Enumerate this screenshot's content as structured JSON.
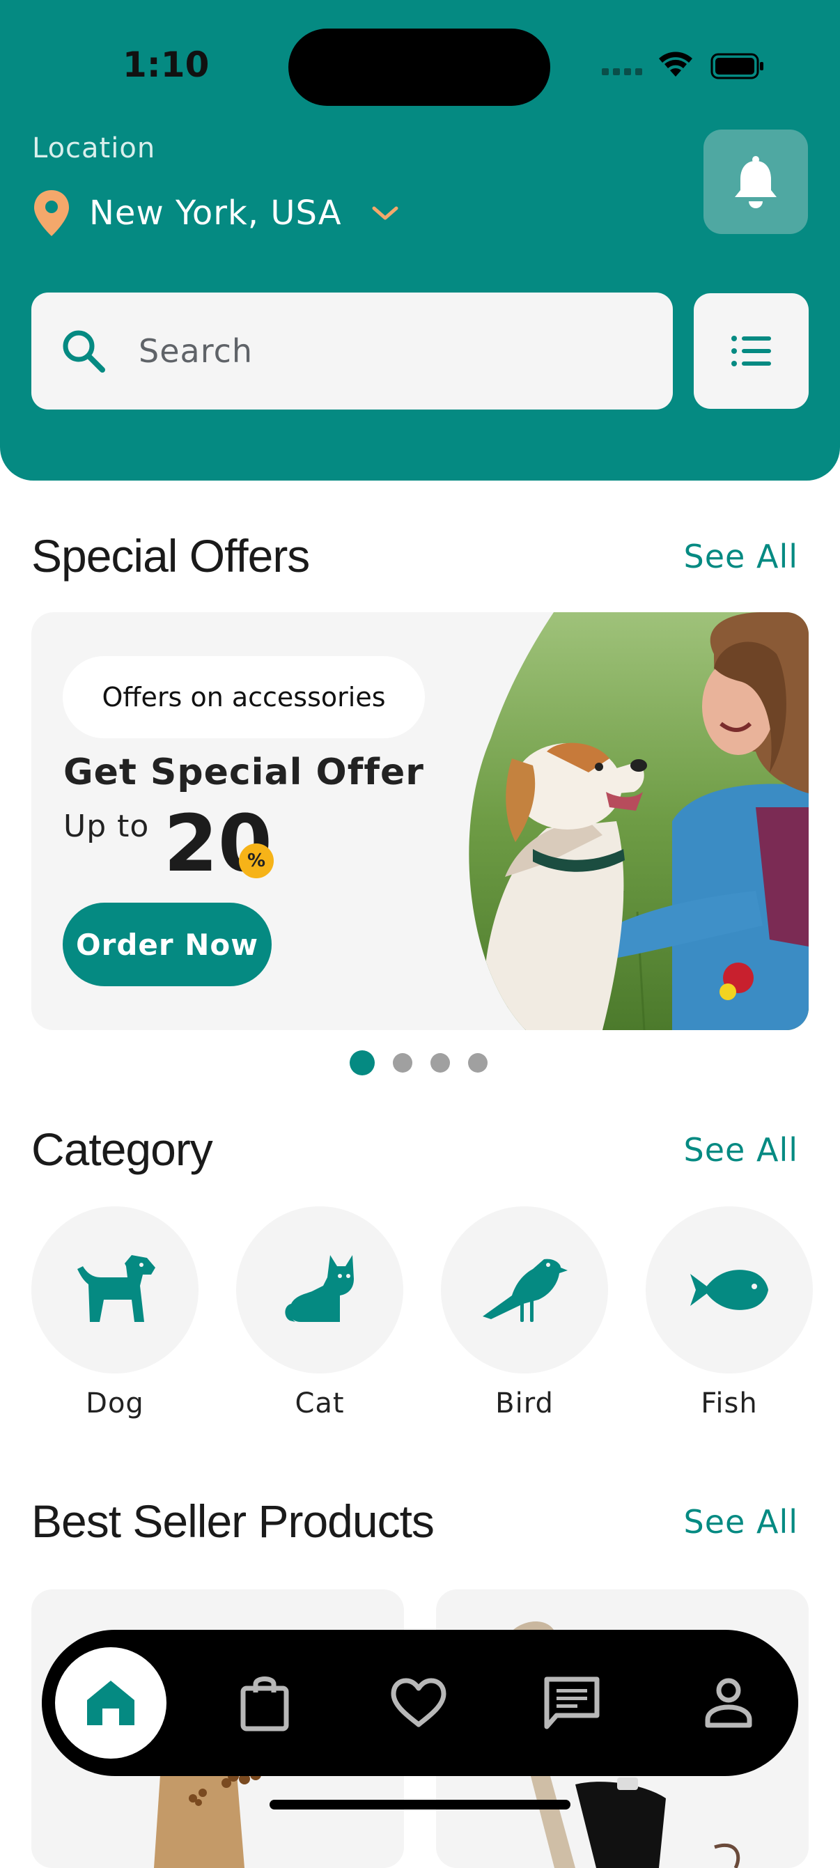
{
  "status_bar": {
    "time": "1:10"
  },
  "header": {
    "location_label": "Location",
    "location_value": "New York, USA",
    "search_placeholder": "Search"
  },
  "special_offers": {
    "title": "Special Offers",
    "see_all": "See All",
    "banner": {
      "pill": "Offers on accessories",
      "title": "Get Special Offer",
      "up_to": "Up to",
      "amount": "20",
      "percent": "%",
      "cta": "Order Now"
    },
    "carousel": {
      "pages": 4,
      "active": 1
    }
  },
  "category": {
    "title": "Category",
    "see_all": "See All",
    "items": [
      {
        "label": "Dog",
        "icon": "dog-icon"
      },
      {
        "label": "Cat",
        "icon": "cat-icon"
      },
      {
        "label": "Bird",
        "icon": "bird-icon"
      },
      {
        "label": "Fish",
        "icon": "fish-icon"
      }
    ]
  },
  "best_seller": {
    "title": "Best Seller Products",
    "see_all": "See All"
  },
  "bottom_nav": {
    "items": [
      "home-icon",
      "bag-icon",
      "heart-icon",
      "chat-icon",
      "profile-icon"
    ],
    "active": "home-icon"
  },
  "colors": {
    "primary": "#058a82",
    "accent": "#f6b318",
    "pin": "#f4a86b"
  }
}
